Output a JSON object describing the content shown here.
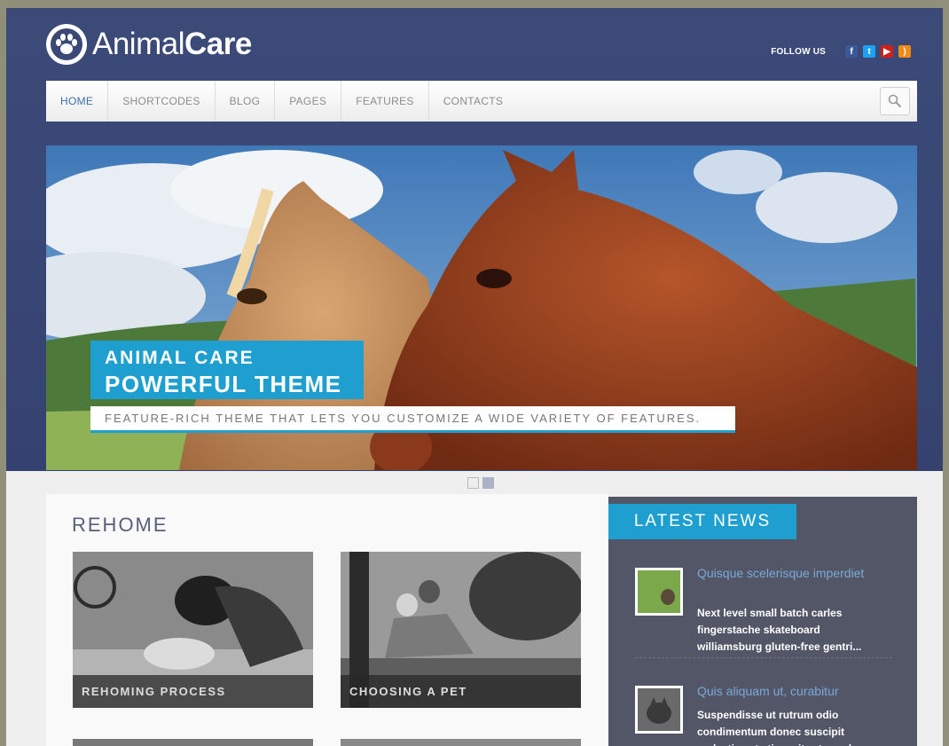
{
  "brand": {
    "name_light": "Animal",
    "name_bold": "Care"
  },
  "header": {
    "follow_label": "FOLLOW US",
    "social": [
      "facebook-icon",
      "twitter-icon",
      "youtube-icon",
      "rss-icon"
    ]
  },
  "nav": {
    "items": [
      "HOME",
      "SHORTCODES",
      "BLOG",
      "PAGES",
      "FEATURES",
      "CONTACTS"
    ],
    "active": "HOME"
  },
  "slider": {
    "caption_line1": "ANIMAL CARE",
    "caption_line2": "POWERFUL THEME",
    "caption_sub": "FEATURE-RICH THEME THAT LETS YOU CUSTOMIZE A WIDE VARIETY OF FEATURES.",
    "active_dot": 2,
    "dot_count": 2
  },
  "rehome": {
    "title": "REHOME",
    "cards": [
      {
        "label": "REHOMING PROCESS"
      },
      {
        "label": "CHOOSING A PET"
      }
    ]
  },
  "news": {
    "title": "LATEST NEWS",
    "items": [
      {
        "headline": "Quisque scelerisque imperdiet",
        "excerpt": "Next level small batch carles fingerstache skateboard williamsburg gluten-free gentri..."
      },
      {
        "headline": "Quis aliquam ut, curabitur",
        "excerpt": "Suspendisse ut rutrum odio condimentum donec suscipit molestie sat etiam sit rutrum d"
      }
    ]
  },
  "colors": {
    "accent": "#1e9fd0",
    "header_bg": "#3a4876",
    "news_bg": "#525667"
  }
}
